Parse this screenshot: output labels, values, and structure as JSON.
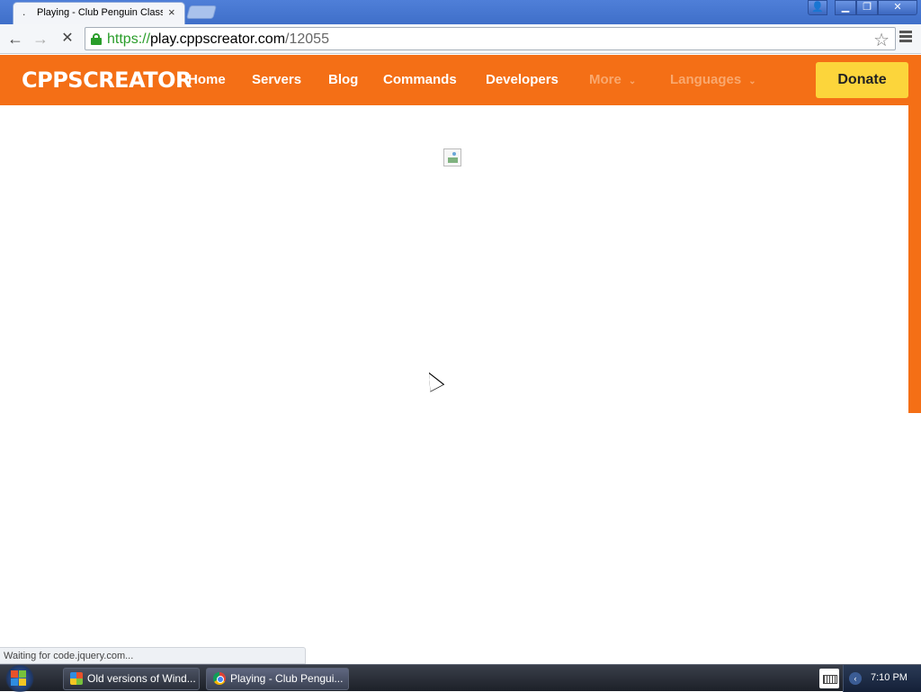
{
  "browser": {
    "tab": {
      "title": "Playing - Club Penguin Classic",
      "close": "×"
    },
    "window_buttons": {
      "user": "👤",
      "minimize": "▁",
      "maximize": "❐",
      "close": "✕"
    },
    "nav": {
      "back": "←",
      "forward": "→",
      "stop": "✕"
    },
    "url": {
      "scheme": "https://",
      "host": "play.cppscreator.com",
      "path": "/12055"
    },
    "star": "☆",
    "status_text": "Waiting for code.jquery.com..."
  },
  "site": {
    "logo": "CPPSCREATOR",
    "nav_items": [
      {
        "label": "Home"
      },
      {
        "label": "Servers"
      },
      {
        "label": "Blog"
      },
      {
        "label": "Commands"
      },
      {
        "label": "Developers"
      },
      {
        "label": "More",
        "dropdown": true
      },
      {
        "label": "Languages",
        "dropdown": true
      }
    ],
    "dropdown_chevron": "⌄",
    "donate_label": "Donate",
    "colors": {
      "brand_orange": "#f46f16",
      "donate_yellow": "#fcd53b"
    }
  },
  "taskbar": {
    "tasks": [
      {
        "label": "Old versions of Wind...",
        "icon": "windows-icon"
      },
      {
        "label": "Playing - Club Pengui...",
        "icon": "chrome-icon"
      }
    ],
    "tray_chevron": "‹",
    "clock": "7:10 PM"
  }
}
